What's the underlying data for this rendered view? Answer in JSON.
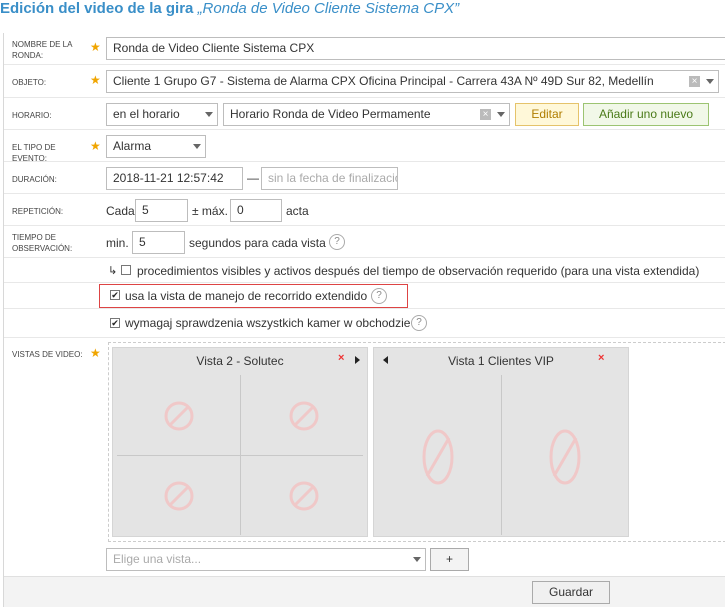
{
  "header": {
    "title": "Edición del video de la gira",
    "subtitle": "„Ronda de Video Cliente Sistema CPX”"
  },
  "fields": {
    "name": {
      "label": "NOMBRE DE LA RONDA:",
      "value": "Ronda de Video Cliente Sistema CPX"
    },
    "object": {
      "label": "OBJETO:",
      "value": "Cliente 1 Grupo G7 - Sistema de Alarma CPX Oficina Principal - Carrera 43A Nº 49D Sur 82, Medellín"
    },
    "schedule": {
      "label": "HORARIO:",
      "mode": "en el horario",
      "value": "Horario Ronda de Video Permamente",
      "edit_button": "Editar",
      "add_button": "Añadir uno nuevo"
    },
    "event_type": {
      "label": "EL TIPO DE EVENTO:",
      "value": "Alarma"
    },
    "duration": {
      "label": "DURACIÓN:",
      "start": "2018-11-21 12:57:42",
      "separator": "—",
      "end_placeholder": "sin la fecha de finalizació"
    },
    "repeat": {
      "label": "REPETICIÓN:",
      "prefix": "Cada",
      "value": "5",
      "mid": "± máx.",
      "max": "0",
      "suffix": "acta"
    },
    "observation": {
      "label": "TIEMPO DE OBSERVACIÓN:",
      "prefix": "min.",
      "value": "5",
      "suffix": "segundos para cada vista"
    },
    "option1": {
      "arrow": "↳",
      "text": "procedimientos visibles y activos después del tiempo de observación requerido (para una vista extendida)",
      "checked": false
    },
    "option2": {
      "text": "usa la vista de manejo de recorrido extendido",
      "checked": true
    },
    "option3": {
      "text": "wymagaj sprawdzenia wszystkich kamer w obchodzie",
      "checked": true
    },
    "views": {
      "label": "VISTAS DE VIDEO:",
      "items": [
        {
          "title": "Vista 2 - Solutec"
        },
        {
          "title": "Vista 1 Clientes VIP"
        }
      ],
      "select_placeholder": "Elige una vista...",
      "add_button": "+"
    }
  },
  "help_symbol": "?",
  "clear_symbol": "×",
  "check_symbol": "✔",
  "save_button": "Guardar",
  "colors": {
    "accent": "#3a8fc8",
    "required_star": "#f0a500",
    "remove": "#e33333",
    "no_camera": "#f0c8c8"
  },
  "icons": {
    "remove": "close-icon",
    "camera_off": "no-signal-icon"
  }
}
